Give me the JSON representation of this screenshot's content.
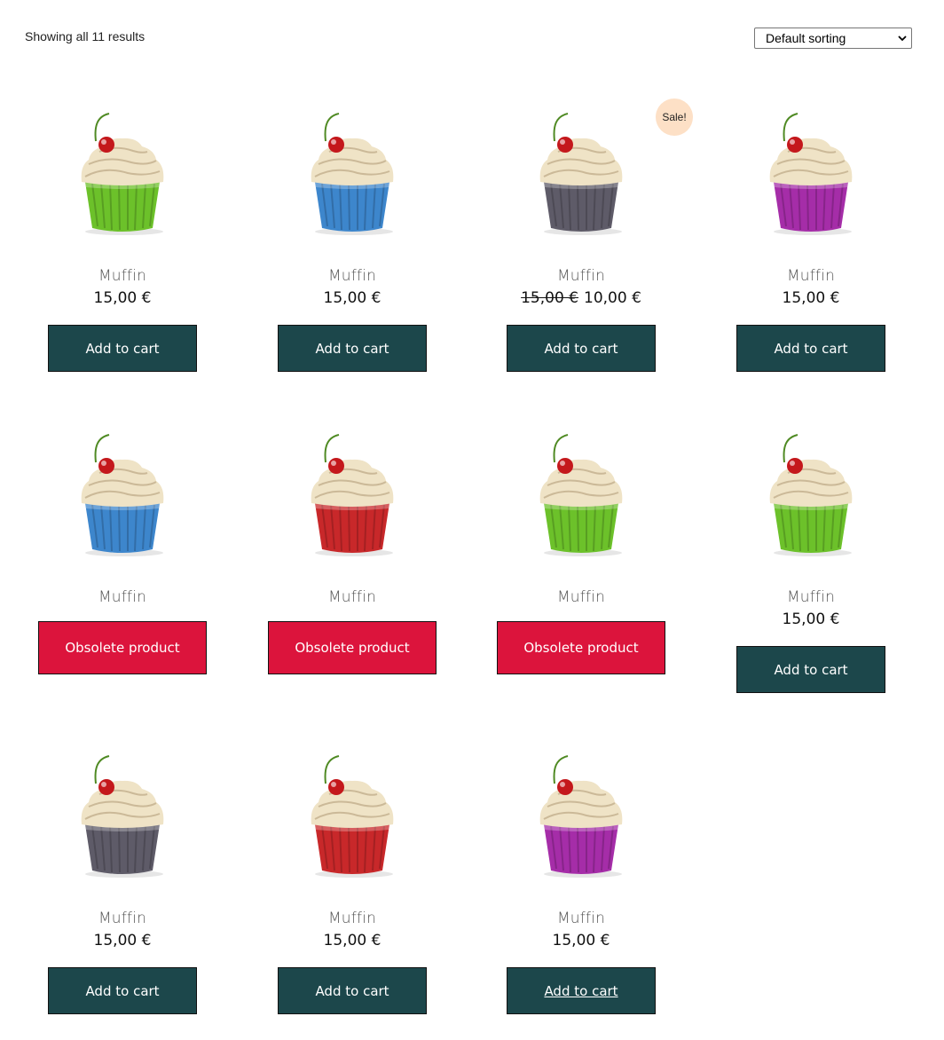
{
  "toolbar": {
    "result_count": "Showing all 11 results",
    "sorting_selected": "Default sorting"
  },
  "sale_badge": "Sale!",
  "products": [
    {
      "title": "Muffin",
      "price": "15,00 €",
      "old_price": "",
      "button": "Add to cart",
      "button_type": "cart",
      "liner_color": "#6cc12a"
    },
    {
      "title": "Muffin",
      "price": "15,00 €",
      "old_price": "",
      "button": "Add to cart",
      "button_type": "cart",
      "liner_color": "#3d86cc"
    },
    {
      "title": "Muffin",
      "price": "10,00 €",
      "old_price": "15,00 €",
      "button": "Add to cart",
      "button_type": "cart",
      "liner_color": "#5e5b68"
    },
    {
      "title": "Muffin",
      "price": "15,00 €",
      "old_price": "",
      "button": "Add to cart",
      "button_type": "cart",
      "liner_color": "#a52da8"
    },
    {
      "title": "Muffin",
      "price": "",
      "old_price": "",
      "button": "Obsolete product",
      "button_type": "obsolete",
      "liner_color": "#3d86cc"
    },
    {
      "title": "Muffin",
      "price": "",
      "old_price": "",
      "button": "Obsolete product",
      "button_type": "obsolete",
      "liner_color": "#c8282a"
    },
    {
      "title": "Muffin",
      "price": "",
      "old_price": "",
      "button": "Obsolete product",
      "button_type": "obsolete",
      "liner_color": "#6cc12a"
    },
    {
      "title": "Muffin",
      "price": "15,00 €",
      "old_price": "",
      "button": "Add to cart",
      "button_type": "cart",
      "liner_color": "#6cc12a"
    },
    {
      "title": "Muffin",
      "price": "15,00 €",
      "old_price": "",
      "button": "Add to cart",
      "button_type": "cart",
      "liner_color": "#5e5b68"
    },
    {
      "title": "Muffin",
      "price": "15,00 €",
      "old_price": "",
      "button": "Add to cart",
      "button_type": "cart",
      "liner_color": "#c8282a"
    },
    {
      "title": "Muffin",
      "price": "15,00 €",
      "old_price": "",
      "button": "Add to cart",
      "button_type": "cart",
      "liner_color": "#a52da8"
    }
  ],
  "colors": {
    "cart_button": "#1c474b",
    "obsolete_button": "#dc143c",
    "sale_badge": "#fde0c6"
  }
}
